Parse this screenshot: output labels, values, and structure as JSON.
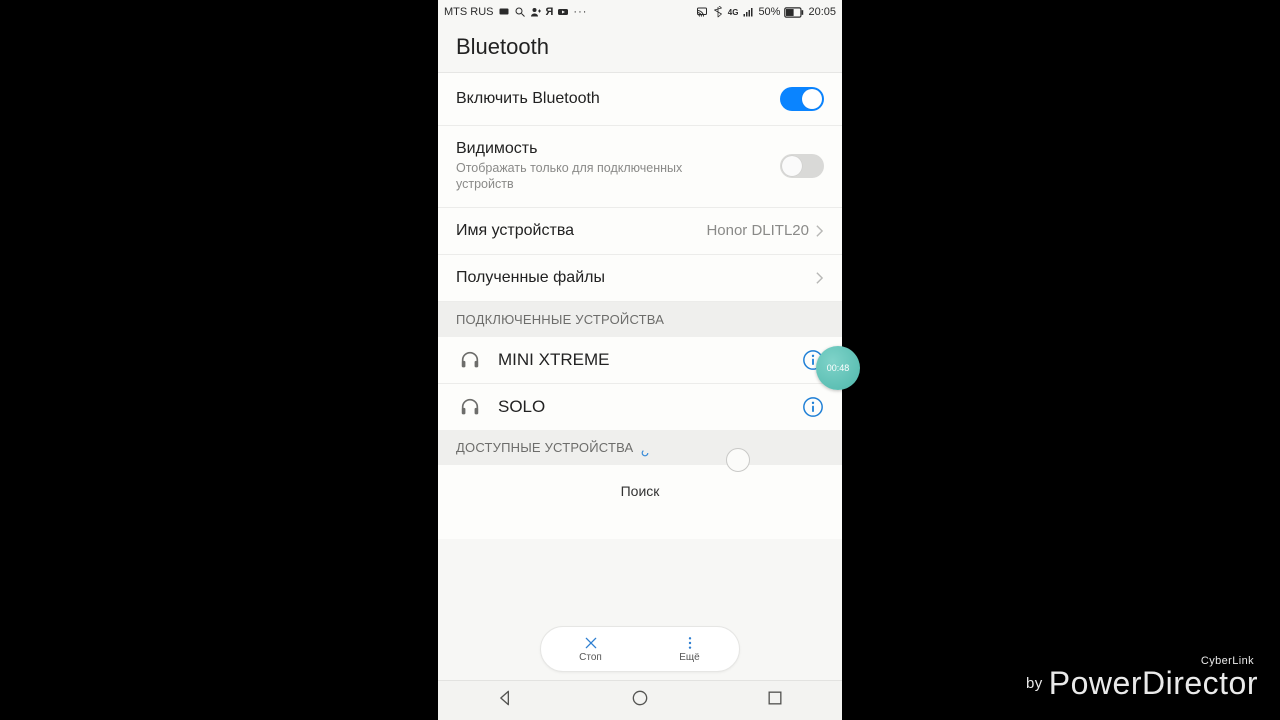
{
  "statusbar": {
    "carrier": "MTS RUS",
    "battery_pct": "50%",
    "time": "20:05"
  },
  "title": "Bluetooth",
  "rows": {
    "enable": {
      "label": "Включить Bluetooth",
      "on": true
    },
    "visibility": {
      "label": "Видимость",
      "sub": "Отображать только для подключенных устройств",
      "on": false
    },
    "device_name": {
      "label": "Имя устройства",
      "value": "Honor DLITL20"
    },
    "received": {
      "label": "Полученные файлы"
    }
  },
  "sections": {
    "paired": "ПОДКЛЮЧЕННЫЕ УСТРОЙСТВА",
    "available": "ДОСТУПНЫЕ УСТРОЙСТВА"
  },
  "paired_devices": [
    {
      "name": "MINI XTREME"
    },
    {
      "name": "SOLO"
    }
  ],
  "searching_label": "Поиск",
  "pill": {
    "stop": "Стоп",
    "more": "Ещё"
  },
  "recorder_time": "00:48",
  "watermark": {
    "brand": "CyberLink",
    "by": "by",
    "product": "PowerDirector"
  }
}
